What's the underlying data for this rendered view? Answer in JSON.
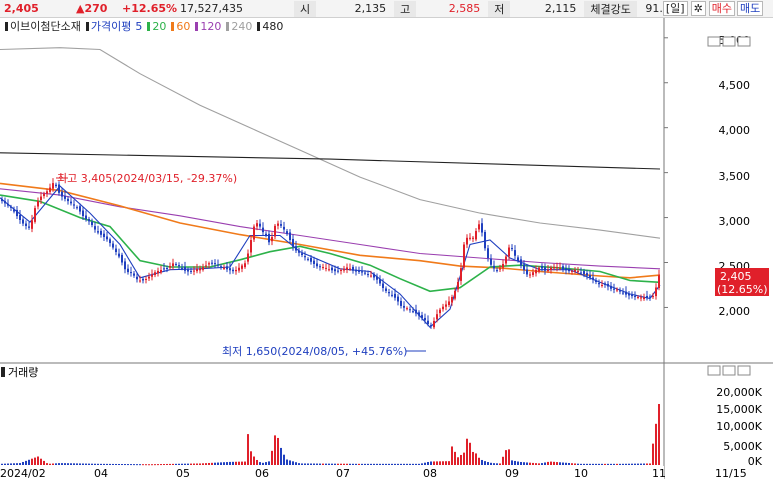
{
  "topbar": {
    "price": "2,405",
    "change": "▲270",
    "pct": "+12.65%",
    "volume": "17,527,435",
    "open_label": "시",
    "open": "2,135",
    "high_label": "고",
    "high": "2,585",
    "low_label": "저",
    "low": "2,115",
    "strength_label": "체결강도",
    "strength": "91.",
    "period_button": "[일]",
    "settings_icon": "gear-icon",
    "buy_button": "매수",
    "sell_button": "매도"
  },
  "legend": {
    "name": "이브이첨단소재",
    "ma_label": "가격이평",
    "items": [
      {
        "label": "5",
        "color": "#1f3fbf"
      },
      {
        "label": "20",
        "color": "#2db24a"
      },
      {
        "label": "60",
        "color": "#f07a1a"
      },
      {
        "label": "120",
        "color": "#9a3fb0"
      },
      {
        "label": "240",
        "color": "#a0a0a0"
      },
      {
        "label": "480",
        "color": "#222222"
      }
    ]
  },
  "axis": {
    "price_ticks": [
      "5,000",
      "4,500",
      "4,000",
      "3,500",
      "3,000",
      "2,500",
      "2,000"
    ],
    "volume_ticks": [
      "20,000K",
      "15,000K",
      "10,000K",
      "5,000K",
      "0K"
    ],
    "x_labels": [
      "2024/02",
      "04",
      "05",
      "06",
      "07",
      "08",
      "09",
      "10",
      "11",
      "11/15"
    ],
    "current_price": "2,405",
    "current_pct": "(12.65%)"
  },
  "annotations": {
    "high": "최고 3,405(2024/03/15, -29.37%)",
    "low": "최저 1,650(2024/08/05, +45.76%)"
  },
  "volume_panel": {
    "title": "거래량"
  },
  "colors": {
    "up": "#e0202a",
    "down": "#1f3fbf"
  },
  "chart_data": {
    "type": "candlestick",
    "ylim": [
      1560,
      5120
    ],
    "volume_ylim": [
      0,
      22000
    ],
    "price_path": [
      [
        0,
        3200
      ],
      [
        6,
        3150
      ],
      [
        12,
        3100
      ],
      [
        18,
        3000
      ],
      [
        24,
        2920
      ],
      [
        30,
        2880
      ],
      [
        36,
        3150
      ],
      [
        42,
        3250
      ],
      [
        48,
        3300
      ],
      [
        54,
        3400
      ],
      [
        60,
        3250
      ],
      [
        66,
        3200
      ],
      [
        72,
        3150
      ],
      [
        78,
        3100
      ],
      [
        84,
        3000
      ],
      [
        90,
        2950
      ],
      [
        96,
        2850
      ],
      [
        102,
        2800
      ],
      [
        108,
        2750
      ],
      [
        114,
        2650
      ],
      [
        120,
        2550
      ],
      [
        126,
        2400
      ],
      [
        132,
        2380
      ],
      [
        138,
        2300
      ],
      [
        144,
        2300
      ],
      [
        150,
        2350
      ],
      [
        156,
        2400
      ],
      [
        162,
        2420
      ],
      [
        168,
        2440
      ],
      [
        174,
        2500
      ],
      [
        180,
        2450
      ],
      [
        186,
        2400
      ],
      [
        192,
        2400
      ],
      [
        198,
        2430
      ],
      [
        204,
        2450
      ],
      [
        210,
        2500
      ],
      [
        216,
        2480
      ],
      [
        222,
        2450
      ],
      [
        228,
        2420
      ],
      [
        234,
        2400
      ],
      [
        240,
        2450
      ],
      [
        246,
        2500
      ],
      [
        250,
        2700
      ],
      [
        254,
        2900
      ],
      [
        258,
        2950
      ],
      [
        262,
        2850
      ],
      [
        266,
        2800
      ],
      [
        270,
        2700
      ],
      [
        276,
        2950
      ],
      [
        282,
        2900
      ],
      [
        288,
        2800
      ],
      [
        294,
        2650
      ],
      [
        300,
        2600
      ],
      [
        306,
        2550
      ],
      [
        312,
        2500
      ],
      [
        318,
        2450
      ],
      [
        324,
        2450
      ],
      [
        330,
        2420
      ],
      [
        336,
        2400
      ],
      [
        342,
        2420
      ],
      [
        348,
        2450
      ],
      [
        354,
        2400
      ],
      [
        360,
        2400
      ],
      [
        366,
        2380
      ],
      [
        372,
        2350
      ],
      [
        378,
        2300
      ],
      [
        384,
        2200
      ],
      [
        390,
        2150
      ],
      [
        396,
        2100
      ],
      [
        402,
        2000
      ],
      [
        408,
        1990
      ],
      [
        414,
        1950
      ],
      [
        420,
        1900
      ],
      [
        426,
        1850
      ],
      [
        430,
        1780
      ],
      [
        434,
        1850
      ],
      [
        438,
        1950
      ],
      [
        442,
        2000
      ],
      [
        448,
        2050
      ],
      [
        454,
        2150
      ],
      [
        460,
        2350
      ],
      [
        464,
        2700
      ],
      [
        468,
        2800
      ],
      [
        472,
        2750
      ],
      [
        476,
        2850
      ],
      [
        480,
        2950
      ],
      [
        486,
        2600
      ],
      [
        492,
        2450
      ],
      [
        498,
        2400
      ],
      [
        504,
        2500
      ],
      [
        510,
        2700
      ],
      [
        516,
        2550
      ],
      [
        522,
        2450
      ],
      [
        528,
        2350
      ],
      [
        534,
        2400
      ],
      [
        540,
        2450
      ],
      [
        546,
        2400
      ],
      [
        552,
        2450
      ],
      [
        558,
        2450
      ],
      [
        564,
        2420
      ],
      [
        570,
        2400
      ],
      [
        576,
        2420
      ],
      [
        582,
        2380
      ],
      [
        588,
        2350
      ],
      [
        594,
        2300
      ],
      [
        600,
        2250
      ],
      [
        606,
        2250
      ],
      [
        612,
        2200
      ],
      [
        618,
        2200
      ],
      [
        624,
        2150
      ],
      [
        630,
        2130
      ],
      [
        636,
        2120
      ],
      [
        642,
        2110
      ],
      [
        648,
        2110
      ],
      [
        654,
        2130
      ],
      [
        660,
        2405
      ]
    ],
    "ma": [
      {
        "name": "120",
        "color": "#9a3fb0",
        "points": [
          [
            0,
            3320
          ],
          [
            60,
            3250
          ],
          [
            120,
            3120
          ],
          [
            180,
            3020
          ],
          [
            240,
            2900
          ],
          [
            300,
            2800
          ],
          [
            360,
            2700
          ],
          [
            420,
            2600
          ],
          [
            480,
            2550
          ],
          [
            540,
            2500
          ],
          [
            600,
            2460
          ],
          [
            660,
            2430
          ]
        ]
      },
      {
        "name": "240",
        "color": "#a0a0a0",
        "points": [
          [
            0,
            4870
          ],
          [
            60,
            4890
          ],
          [
            100,
            4870
          ],
          [
            140,
            4600
          ],
          [
            200,
            4250
          ],
          [
            260,
            3950
          ],
          [
            300,
            3750
          ],
          [
            360,
            3450
          ],
          [
            420,
            3200
          ],
          [
            480,
            3050
          ],
          [
            540,
            2940
          ],
          [
            600,
            2860
          ],
          [
            660,
            2770
          ]
        ]
      },
      {
        "name": "480",
        "color": "#222222",
        "points": [
          [
            0,
            3720
          ],
          [
            330,
            3650
          ],
          [
            660,
            3540
          ]
        ]
      },
      {
        "name": "60",
        "color": "#f07a1a",
        "points": [
          [
            0,
            3380
          ],
          [
            60,
            3300
          ],
          [
            120,
            3130
          ],
          [
            180,
            2940
          ],
          [
            240,
            2810
          ],
          [
            300,
            2700
          ],
          [
            360,
            2580
          ],
          [
            420,
            2520
          ],
          [
            460,
            2460
          ],
          [
            500,
            2440
          ],
          [
            540,
            2400
          ],
          [
            600,
            2350
          ],
          [
            630,
            2330
          ],
          [
            660,
            2360
          ]
        ]
      },
      {
        "name": "20",
        "color": "#2db24a",
        "points": [
          [
            0,
            3250
          ],
          [
            40,
            3180
          ],
          [
            80,
            3000
          ],
          [
            110,
            2900
          ],
          [
            140,
            2520
          ],
          [
            170,
            2450
          ],
          [
            210,
            2450
          ],
          [
            240,
            2530
          ],
          [
            270,
            2620
          ],
          [
            300,
            2680
          ],
          [
            330,
            2600
          ],
          [
            370,
            2470
          ],
          [
            400,
            2320
          ],
          [
            430,
            2180
          ],
          [
            460,
            2220
          ],
          [
            490,
            2450
          ],
          [
            520,
            2470
          ],
          [
            560,
            2440
          ],
          [
            600,
            2400
          ],
          [
            630,
            2300
          ],
          [
            660,
            2280
          ]
        ]
      },
      {
        "name": "5",
        "color": "#1f3fbf",
        "points": [
          [
            0,
            3220
          ],
          [
            30,
            2950
          ],
          [
            60,
            3350
          ],
          [
            90,
            3050
          ],
          [
            120,
            2700
          ],
          [
            140,
            2330
          ],
          [
            170,
            2420
          ],
          [
            200,
            2430
          ],
          [
            230,
            2450
          ],
          [
            250,
            2800
          ],
          [
            280,
            2800
          ],
          [
            300,
            2620
          ],
          [
            340,
            2430
          ],
          [
            370,
            2400
          ],
          [
            400,
            2150
          ],
          [
            430,
            1780
          ],
          [
            450,
            1980
          ],
          [
            470,
            2700
          ],
          [
            490,
            2750
          ],
          [
            510,
            2550
          ],
          [
            540,
            2420
          ],
          [
            570,
            2420
          ],
          [
            600,
            2280
          ],
          [
            630,
            2150
          ],
          [
            650,
            2100
          ],
          [
            660,
            2250
          ]
        ]
      }
    ],
    "volume_path": [
      [
        0,
        300
      ],
      [
        20,
        500
      ],
      [
        38,
        2200
      ],
      [
        48,
        300
      ],
      [
        60,
        500
      ],
      [
        100,
        300
      ],
      [
        150,
        200
      ],
      [
        200,
        400
      ],
      [
        230,
        800
      ],
      [
        246,
        900
      ],
      [
        248,
        8000
      ],
      [
        250,
        4000
      ],
      [
        254,
        2200
      ],
      [
        258,
        1000
      ],
      [
        262,
        500
      ],
      [
        270,
        1000
      ],
      [
        276,
        9000
      ],
      [
        280,
        5000
      ],
      [
        286,
        1500
      ],
      [
        300,
        400
      ],
      [
        360,
        300
      ],
      [
        400,
        300
      ],
      [
        420,
        300
      ],
      [
        430,
        900
      ],
      [
        450,
        1000
      ],
      [
        452,
        4800
      ],
      [
        458,
        2000
      ],
      [
        464,
        3200
      ],
      [
        468,
        8000
      ],
      [
        472,
        3500
      ],
      [
        476,
        3000
      ],
      [
        480,
        1500
      ],
      [
        486,
        900
      ],
      [
        492,
        500
      ],
      [
        500,
        400
      ],
      [
        508,
        5000
      ],
      [
        512,
        1200
      ],
      [
        520,
        800
      ],
      [
        540,
        400
      ],
      [
        550,
        900
      ],
      [
        580,
        300
      ],
      [
        620,
        300
      ],
      [
        650,
        400
      ],
      [
        660,
        17500
      ]
    ]
  }
}
